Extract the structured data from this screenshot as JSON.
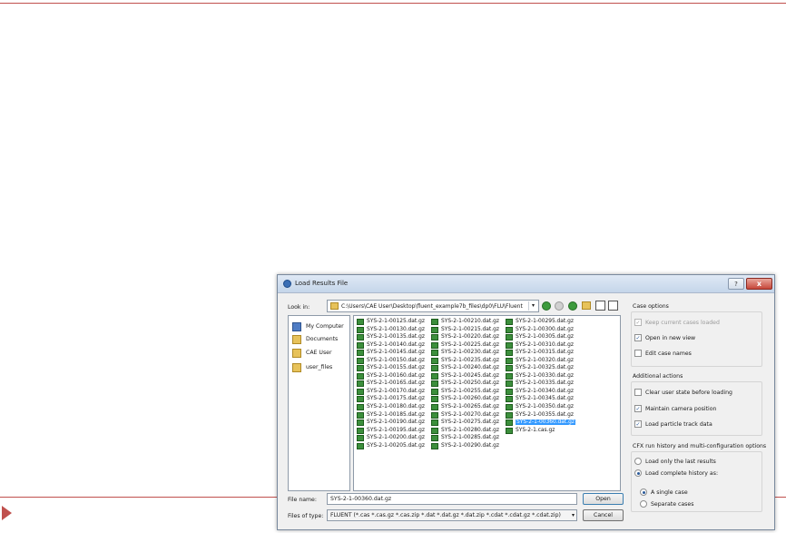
{
  "dialog": {
    "title": "Load Results File",
    "help_label": "?",
    "close_label": "x"
  },
  "lookin": {
    "label": "Look in:",
    "path": "C:\\Users\\CAE User\\Desktop\\fluent_example7b_files\\dp0\\FLU\\Fluent"
  },
  "places": [
    {
      "label": "My Computer",
      "icon": "computer-icon"
    },
    {
      "label": "Documents",
      "icon": "folder-icon"
    },
    {
      "label": "CAE User",
      "icon": "folder-icon"
    },
    {
      "label": "user_files",
      "icon": "folder-icon"
    }
  ],
  "files": {
    "col1": [
      "SYS-2-1-00125.dat.gz",
      "SYS-2-1-00130.dat.gz",
      "SYS-2-1-00135.dat.gz",
      "SYS-2-1-00140.dat.gz",
      "SYS-2-1-00145.dat.gz",
      "SYS-2-1-00150.dat.gz",
      "SYS-2-1-00155.dat.gz",
      "SYS-2-1-00160.dat.gz",
      "SYS-2-1-00165.dat.gz",
      "SYS-2-1-00170.dat.gz",
      "SYS-2-1-00175.dat.gz",
      "SYS-2-1-00180.dat.gz",
      "SYS-2-1-00185.dat.gz",
      "SYS-2-1-00190.dat.gz",
      "SYS-2-1-00195.dat.gz",
      "SYS-2-1-00200.dat.gz",
      "SYS-2-1-00205.dat.gz"
    ],
    "col2": [
      "SYS-2-1-00210.dat.gz",
      "SYS-2-1-00215.dat.gz",
      "SYS-2-1-00220.dat.gz",
      "SYS-2-1-00225.dat.gz",
      "SYS-2-1-00230.dat.gz",
      "SYS-2-1-00235.dat.gz",
      "SYS-2-1-00240.dat.gz",
      "SYS-2-1-00245.dat.gz",
      "SYS-2-1-00250.dat.gz",
      "SYS-2-1-00255.dat.gz",
      "SYS-2-1-00260.dat.gz",
      "SYS-2-1-00265.dat.gz",
      "SYS-2-1-00270.dat.gz",
      "SYS-2-1-00275.dat.gz",
      "SYS-2-1-00280.dat.gz",
      "SYS-2-1-00285.dat.gz",
      "SYS-2-1-00290.dat.gz"
    ],
    "col3": [
      "SYS-2-1-00295.dat.gz",
      "SYS-2-1-00300.dat.gz",
      "SYS-2-1-00305.dat.gz",
      "SYS-2-1-00310.dat.gz",
      "SYS-2-1-00315.dat.gz",
      "SYS-2-1-00320.dat.gz",
      "SYS-2-1-00325.dat.gz",
      "SYS-2-1-00330.dat.gz",
      "SYS-2-1-00335.dat.gz",
      "SYS-2-1-00340.dat.gz",
      "SYS-2-1-00345.dat.gz",
      "SYS-2-1-00350.dat.gz",
      "SYS-2-1-00355.dat.gz",
      "SYS-2-1-00360.dat.gz",
      "SYS-2-1.cas.gz"
    ],
    "selected": "SYS-2-1-00360.dat.gz"
  },
  "filename": {
    "label": "File name:",
    "value": "SYS-2-1-00360.dat.gz"
  },
  "filetype": {
    "label": "Files of type:",
    "value": "FLUENT (*.cas *.cas.gz *.cas.zip *.dat *.dat.gz *.dat.zip *.cdat *.cdat.gz *.cdat.zip)"
  },
  "buttons": {
    "open": "Open",
    "cancel": "Cancel"
  },
  "case_options": {
    "title": "Case options",
    "keep_current": {
      "label": "Keep current cases loaded",
      "checked": true,
      "disabled": true
    },
    "open_new_view": {
      "label": "Open in new view",
      "checked": true
    },
    "edit_case_names": {
      "label": "Edit case names",
      "checked": false
    }
  },
  "additional_actions": {
    "title": "Additional actions",
    "clear_user_state": {
      "label": "Clear user state before loading",
      "checked": false
    },
    "maintain_camera": {
      "label": "Maintain camera position",
      "checked": true
    },
    "load_particle": {
      "label": "Load particle track data",
      "checked": true
    }
  },
  "cfx_history": {
    "title": "CFX run history and multi-configuration options",
    "last_results": {
      "label": "Load only the last results",
      "selected": false
    },
    "complete_history": {
      "label": "Load complete history as:",
      "selected": true
    },
    "single_case": {
      "label": "A single case",
      "selected": true
    },
    "separate_cases": {
      "label": "Separate cases",
      "selected": false
    }
  },
  "colors": {
    "accent_line": "#c0504d",
    "selection": "#3399ff"
  }
}
